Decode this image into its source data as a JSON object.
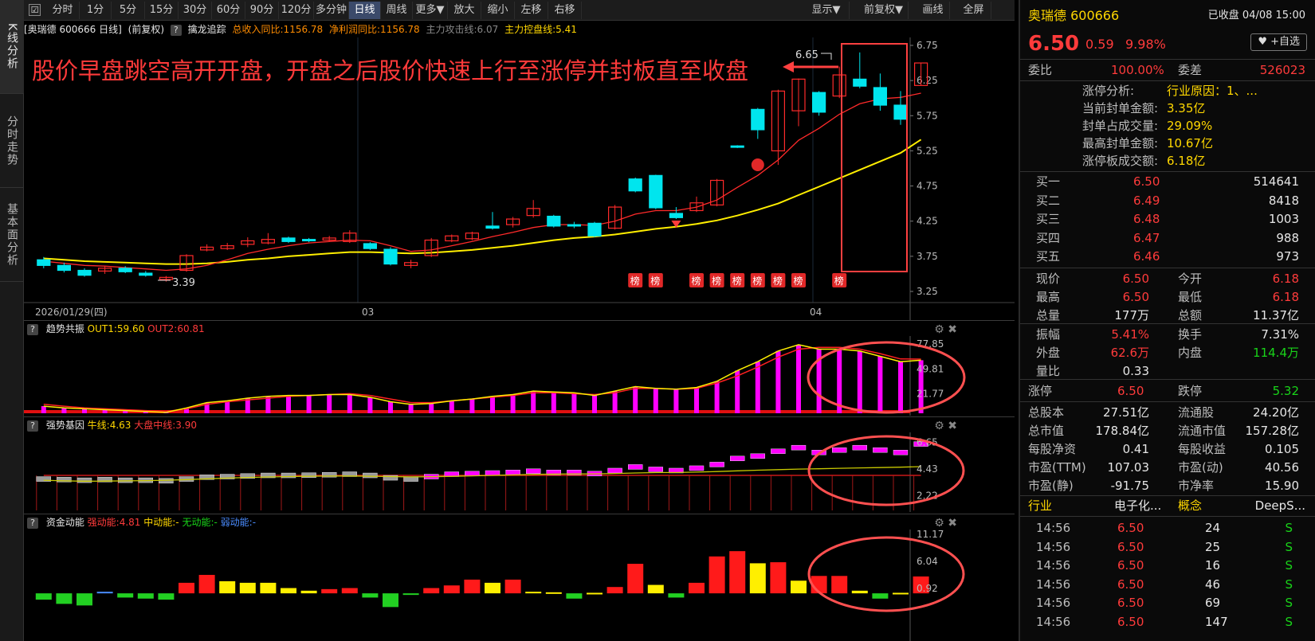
{
  "side_tabs": [
    "K线分析",
    "分时走势",
    "基本面分析"
  ],
  "toolbar": {
    "checkbox": "☑",
    "periods": [
      "分时",
      "1分",
      "5分",
      "15分",
      "30分",
      "60分",
      "90分",
      "120分",
      "多分钟",
      "日线",
      "周线",
      "更多▼"
    ],
    "active_period": "日线",
    "actions": [
      "放大",
      "缩小",
      "左移",
      "右移"
    ],
    "right": [
      "显示▼",
      "前复权▼",
      "画线",
      "全屏"
    ]
  },
  "info": {
    "title": "[奥瑞德 600666 日线]",
    "adjust": "(前复权)",
    "q": "?",
    "indicator": "擒龙追踪",
    "revenue": "总收入同比:1156.78",
    "profit": "净利润同比:1156.78",
    "attack": "主力攻击线:6.07",
    "control": "主力控盘线:5.41"
  },
  "annotation": "股价早盘跳空高开开盘，开盘之后股价快速上行至涨停并封板直至收盘",
  "main_chart": {
    "y_ticks": [
      "6.75",
      "6.25",
      "5.75",
      "5.25",
      "4.75",
      "4.25",
      "3.75",
      "3.25"
    ],
    "high_label": "6.65",
    "low_label": "3.39",
    "date_label": "2026/01/29(四)",
    "month_03": "03",
    "month_04": "04",
    "bang": "榜"
  },
  "chart_data": [
    {
      "type": "candlestick",
      "title": "",
      "ylim": [
        3.25,
        6.75
      ],
      "candles": [
        {
          "o": 3.7,
          "c": 3.62,
          "h": 3.74,
          "l": 3.58
        },
        {
          "o": 3.62,
          "c": 3.55,
          "h": 3.66,
          "l": 3.52
        },
        {
          "o": 3.55,
          "c": 3.48,
          "h": 3.58,
          "l": 3.46
        },
        {
          "o": 3.54,
          "c": 3.58,
          "h": 3.61,
          "l": 3.5
        },
        {
          "o": 3.58,
          "c": 3.53,
          "h": 3.61,
          "l": 3.51
        },
        {
          "o": 3.51,
          "c": 3.48,
          "h": 3.54,
          "l": 3.46
        },
        {
          "o": 3.42,
          "c": 3.45,
          "h": 3.47,
          "l": 3.39
        },
        {
          "o": 3.55,
          "c": 3.76,
          "h": 3.78,
          "l": 3.53
        },
        {
          "o": 3.84,
          "c": 3.88,
          "h": 3.92,
          "l": 3.82
        },
        {
          "o": 3.86,
          "c": 3.9,
          "h": 3.94,
          "l": 3.84
        },
        {
          "o": 3.92,
          "c": 3.97,
          "h": 4.02,
          "l": 3.88
        },
        {
          "o": 3.94,
          "c": 3.99,
          "h": 4.08,
          "l": 3.92
        },
        {
          "o": 4.01,
          "c": 3.96,
          "h": 4.03,
          "l": 3.94
        },
        {
          "o": 3.99,
          "c": 3.97,
          "h": 4.01,
          "l": 3.95
        },
        {
          "o": 3.98,
          "c": 4.01,
          "h": 4.04,
          "l": 3.96
        },
        {
          "o": 3.96,
          "c": 4.08,
          "h": 4.12,
          "l": 3.94
        },
        {
          "o": 3.93,
          "c": 3.86,
          "h": 3.95,
          "l": 3.84
        },
        {
          "o": 3.85,
          "c": 3.64,
          "h": 3.88,
          "l": 3.62
        },
        {
          "o": 3.62,
          "c": 3.66,
          "h": 3.7,
          "l": 3.58
        },
        {
          "o": 3.76,
          "c": 3.98,
          "h": 4.01,
          "l": 3.74
        },
        {
          "o": 3.97,
          "c": 4.04,
          "h": 4.06,
          "l": 3.95
        },
        {
          "o": 4.0,
          "c": 4.08,
          "h": 4.1,
          "l": 3.98
        },
        {
          "o": 4.18,
          "c": 4.15,
          "h": 4.38,
          "l": 4.13
        },
        {
          "o": 4.2,
          "c": 4.28,
          "h": 4.31,
          "l": 4.16
        },
        {
          "o": 4.33,
          "c": 4.43,
          "h": 4.55,
          "l": 4.3
        },
        {
          "o": 4.32,
          "c": 4.18,
          "h": 4.34,
          "l": 4.16
        },
        {
          "o": 4.2,
          "c": 4.18,
          "h": 4.24,
          "l": 4.15
        },
        {
          "o": 4.22,
          "c": 4.04,
          "h": 4.24,
          "l": 4.02
        },
        {
          "o": 4.15,
          "c": 4.45,
          "h": 4.48,
          "l": 4.13
        },
        {
          "o": 4.85,
          "c": 4.68,
          "h": 4.87,
          "l": 4.66
        },
        {
          "o": 4.9,
          "c": 4.44,
          "h": 4.91,
          "l": 4.42
        },
        {
          "o": 4.36,
          "c": 4.3,
          "h": 4.45,
          "l": 4.28
        },
        {
          "o": 4.4,
          "c": 4.51,
          "h": 4.6,
          "l": 4.38
        },
        {
          "o": 4.48,
          "c": 4.83,
          "h": 4.85,
          "l": 4.46
        },
        {
          "o": 5.32,
          "c": 5.3,
          "h": 5.33,
          "l": 5.29
        },
        {
          "o": 5.84,
          "c": 5.55,
          "h": 5.86,
          "l": 5.42
        },
        {
          "o": 5.25,
          "c": 6.1,
          "h": 6.12,
          "l": 5.05
        },
        {
          "o": 5.82,
          "c": 6.27,
          "h": 6.28,
          "l": 5.6
        },
        {
          "o": 6.08,
          "c": 5.8,
          "h": 6.1,
          "l": 5.75
        },
        {
          "o": 6.03,
          "c": 6.33,
          "h": 6.45,
          "l": 6.0
        },
        {
          "o": 6.27,
          "c": 6.17,
          "h": 6.65,
          "l": 6.14
        },
        {
          "o": 6.15,
          "c": 5.9,
          "h": 6.35,
          "l": 5.82
        },
        {
          "o": 5.9,
          "c": 5.7,
          "h": 6.1,
          "l": 5.62
        },
        {
          "o": 6.18,
          "c": 6.5,
          "h": 6.5,
          "l": 6.18
        }
      ],
      "ma_attack": [
        3.68,
        3.65,
        3.62,
        3.61,
        3.59,
        3.57,
        3.55,
        3.57,
        3.62,
        3.7,
        3.79,
        3.85,
        3.9,
        3.94,
        3.96,
        3.98,
        3.97,
        3.9,
        3.82,
        3.84,
        3.9,
        3.96,
        4.03,
        4.09,
        4.16,
        4.2,
        4.2,
        4.19,
        4.25,
        4.35,
        4.4,
        4.4,
        4.45,
        4.55,
        4.73,
        4.9,
        5.12,
        5.4,
        5.57,
        5.77,
        5.92,
        5.99,
        6.01,
        6.07
      ],
      "ma_control": [
        3.72,
        3.7,
        3.68,
        3.67,
        3.66,
        3.65,
        3.64,
        3.64,
        3.65,
        3.67,
        3.7,
        3.72,
        3.75,
        3.77,
        3.79,
        3.81,
        3.81,
        3.8,
        3.79,
        3.8,
        3.82,
        3.84,
        3.87,
        3.9,
        3.94,
        3.98,
        4.01,
        4.03,
        4.06,
        4.1,
        4.14,
        4.17,
        4.21,
        4.26,
        4.33,
        4.41,
        4.5,
        4.62,
        4.74,
        4.86,
        4.98,
        5.1,
        5.22,
        5.41
      ]
    },
    {
      "type": "bar+line",
      "title": "趋势共振",
      "ylim": [
        0,
        85
      ],
      "series": [
        {
          "name": "OUT1",
          "values": [
            8,
            6,
            5,
            4,
            3,
            2,
            1,
            6,
            12,
            14,
            17,
            19,
            20,
            20,
            21,
            21,
            18,
            13,
            10,
            11,
            14,
            16,
            19,
            21,
            25,
            24,
            23,
            20,
            25,
            30,
            28,
            27,
            29,
            36,
            48,
            58,
            70,
            77,
            72,
            72,
            70,
            64,
            58,
            59.6
          ]
        },
        {
          "name": "OUT2",
          "values": [
            10,
            8,
            6,
            5,
            4,
            3,
            2,
            5,
            10,
            13,
            15,
            17,
            19,
            20,
            21,
            22,
            20,
            16,
            12,
            12,
            14,
            16,
            18,
            20,
            23,
            23,
            22,
            21,
            23,
            28,
            28,
            27,
            28,
            34,
            42,
            52,
            63,
            72,
            74,
            74,
            72,
            67,
            61,
            60.81
          ]
        }
      ],
      "values": [
        8,
        6,
        5,
        4,
        3,
        2,
        1,
        6,
        12,
        14,
        17,
        19,
        20,
        20,
        21,
        21,
        18,
        13,
        10,
        11,
        14,
        16,
        19,
        21,
        25,
        24,
        23,
        20,
        25,
        30,
        28,
        27,
        29,
        36,
        48,
        58,
        70,
        77,
        72,
        72,
        70,
        64,
        58,
        59.6
      ]
    },
    {
      "type": "bar+line",
      "title": "强势基因",
      "ylim": [
        1,
        7.2
      ],
      "series": [
        {
          "name": "牛线",
          "values": [
            3.5,
            3.45,
            3.42,
            3.43,
            3.45,
            3.47,
            3.5,
            3.55,
            3.62,
            3.68,
            3.73,
            3.77,
            3.8,
            3.83,
            3.84,
            3.85,
            3.83,
            3.8,
            3.78,
            3.79,
            3.82,
            3.86,
            3.9,
            3.94,
            3.98,
            4.01,
            4.03,
            4.03,
            4.06,
            4.1,
            4.13,
            4.14,
            4.17,
            4.22,
            4.28,
            4.33,
            4.38,
            4.42,
            4.45,
            4.49,
            4.52,
            4.55,
            4.58,
            4.63
          ]
        },
        {
          "name": "大盘中线",
          "values": [
            3.9,
            3.9,
            3.9,
            3.9,
            3.9,
            3.9,
            3.9,
            3.9,
            3.9,
            3.9,
            3.9,
            3.9,
            3.9,
            3.9,
            3.9,
            3.9,
            3.9,
            3.9,
            3.9,
            3.9,
            3.9,
            3.9,
            3.9,
            3.9,
            3.9,
            3.9,
            3.9,
            3.9,
            3.9,
            3.9,
            3.9,
            3.9,
            3.9,
            3.9,
            3.9,
            3.9,
            3.9,
            3.9,
            3.9,
            3.9,
            3.9,
            3.9,
            3.9,
            3.9
          ]
        }
      ],
      "values": [
        3.6,
        3.55,
        3.5,
        3.55,
        3.5,
        3.5,
        3.45,
        3.6,
        3.75,
        3.8,
        3.85,
        3.9,
        3.9,
        3.92,
        3.95,
        4.0,
        3.9,
        3.7,
        3.6,
        3.8,
        4.0,
        4.05,
        4.1,
        4.15,
        4.25,
        4.15,
        4.15,
        4.05,
        4.3,
        4.6,
        4.4,
        4.3,
        4.5,
        4.8,
        5.3,
        5.5,
        5.9,
        6.2,
        5.8,
        6.0,
        6.2,
        6.0,
        5.8,
        6.5
      ]
    },
    {
      "type": "bar",
      "title": "资金动能",
      "ylim": [
        -3,
        11.5
      ],
      "values": [
        -1.2,
        -2.0,
        -2.3,
        0.3,
        -0.8,
        -1.0,
        -1.2,
        2.0,
        3.5,
        2.3,
        2.0,
        2.0,
        1.0,
        0.5,
        0.8,
        1.0,
        -0.8,
        -2.6,
        -0.2,
        1.0,
        1.5,
        2.6,
        2.0,
        2.6,
        0.3,
        0.2,
        -1.0,
        0.1,
        1.2,
        5.6,
        1.6,
        -0.8,
        2.0,
        7.0,
        8.0,
        5.7,
        5.9,
        2.4,
        3.3,
        3.3,
        0.5,
        -1.0,
        0.1,
        3.2
      ],
      "colors": [
        "#22d022",
        "#22d022",
        "#22d022",
        "#4a8cff",
        "#22d022",
        "#22d022",
        "#22d022",
        "#ff1a1a",
        "#ff1a1a",
        "#ffef00",
        "#ffef00",
        "#ffef00",
        "#ffef00",
        "#ffef00",
        "#ff1a1a",
        "#ff1a1a",
        "#22d022",
        "#22d022",
        "#22d022",
        "#ff1a1a",
        "#ff1a1a",
        "#ff1a1a",
        "#ffef00",
        "#ff1a1a",
        "#ffef00",
        "#ffef00",
        "#22d022",
        "#ffef00",
        "#ff1a1a",
        "#ff1a1a",
        "#ffef00",
        "#22d022",
        "#ff1a1a",
        "#ff1a1a",
        "#ff1a1a",
        "#ffef00",
        "#ff1a1a",
        "#ffef00",
        "#ff1a1a",
        "#ff1a1a",
        "#ffef00",
        "#22d022",
        "#ffef00",
        "#ff1a1a"
      ]
    }
  ],
  "panel1": {
    "q": "?",
    "title": "趋势共振",
    "out1": "OUT1:59.60",
    "out2": "OUT2:60.81",
    "ticks": [
      "77.85",
      "49.81",
      "21.77"
    ]
  },
  "panel2": {
    "q": "?",
    "title": "强势基因",
    "bull": "牛线:4.63",
    "mid": "大盘中线:3.90",
    "ticks": [
      "6.65",
      "4.43",
      "2.22"
    ]
  },
  "panel3": {
    "q": "?",
    "title": "资金动能",
    "strong": "强动能:4.81",
    "medium": "中动能:-",
    "none": "无动能:-",
    "weak": "弱动能:-",
    "ticks": [
      "11.17",
      "6.04",
      "0.92"
    ]
  },
  "quote": {
    "name": "奥瑞德 600666",
    "status": "已收盘 04/08 15:00",
    "price": "6.50",
    "change": "0.59",
    "pct": "9.98%",
    "watch": "♥ +自选",
    "weibi_label": "委比",
    "weibi": "100.00%",
    "weicha_label": "委差",
    "weicha": "526023",
    "limit_analysis": [
      {
        "label": "涨停分析:",
        "value": "行业原因：1、..."
      },
      {
        "label": "当前封单金额:",
        "value": "3.35亿"
      },
      {
        "label": "封单占成交量:",
        "value": "29.09%"
      },
      {
        "label": "最高封单金额:",
        "value": "10.67亿"
      },
      {
        "label": "涨停板成交额:",
        "value": "6.18亿"
      }
    ],
    "bids": [
      {
        "label": "买一",
        "price": "6.50",
        "vol": "514641"
      },
      {
        "label": "买二",
        "price": "6.49",
        "vol": "8418"
      },
      {
        "label": "买三",
        "price": "6.48",
        "vol": "1003"
      },
      {
        "label": "买四",
        "price": "6.47",
        "vol": "988"
      },
      {
        "label": "买五",
        "price": "6.46",
        "vol": "973"
      }
    ],
    "stats1": [
      {
        "l1": "现价",
        "v1": "6.50",
        "c1": "red",
        "l2": "今开",
        "v2": "6.18",
        "c2": "red"
      },
      {
        "l1": "最高",
        "v1": "6.50",
        "c1": "red",
        "l2": "最低",
        "v2": "6.18",
        "c2": "red"
      },
      {
        "l1": "总量",
        "v1": "177万",
        "c1": "white",
        "l2": "总额",
        "v2": "11.37亿",
        "c2": "white"
      }
    ],
    "stats2": [
      {
        "l1": "振幅",
        "v1": "5.41%",
        "c1": "red",
        "l2": "换手",
        "v2": "7.31%",
        "c2": "white"
      },
      {
        "l1": "外盘",
        "v1": "62.6万",
        "c1": "red",
        "l2": "内盘",
        "v2": "114.4万",
        "c2": "green"
      },
      {
        "l1": "量比",
        "v1": "0.33",
        "c1": "white",
        "l2": "",
        "v2": "",
        "c2": "white"
      }
    ],
    "limits": {
      "up_label": "涨停",
      "up": "6.50",
      "down_label": "跌停",
      "down": "5.32"
    },
    "fundamentals": [
      {
        "l1": "总股本",
        "v1": "27.51亿",
        "l2": "流通股",
        "v2": "24.20亿"
      },
      {
        "l1": "总市值",
        "v1": "178.84亿",
        "l2": "流通市值",
        "v2": "157.28亿"
      },
      {
        "l1": "每股净资",
        "v1": "0.41",
        "l2": "每股收益",
        "v2": "0.105"
      },
      {
        "l1": "市盈(TTM)",
        "v1": "107.03",
        "l2": "市盈(动)",
        "v2": "40.56"
      },
      {
        "l1": "市盈(静)",
        "v1": "-91.75",
        "l2": "市净率",
        "v2": "15.90"
      }
    ],
    "industry": {
      "l1": "行业",
      "v1": "电子化...",
      "l2": "概念",
      "v2": "DeepS..."
    },
    "ticks": [
      {
        "time": "14:56",
        "price": "6.50",
        "vol": "24",
        "side": "S"
      },
      {
        "time": "14:56",
        "price": "6.50",
        "vol": "25",
        "side": "S"
      },
      {
        "time": "14:56",
        "price": "6.50",
        "vol": "16",
        "side": "S"
      },
      {
        "time": "14:56",
        "price": "6.50",
        "vol": "46",
        "side": "S"
      },
      {
        "time": "14:56",
        "price": "6.50",
        "vol": "69",
        "side": "S"
      },
      {
        "time": "14:56",
        "price": "6.50",
        "vol": "147",
        "side": "S"
      }
    ]
  }
}
